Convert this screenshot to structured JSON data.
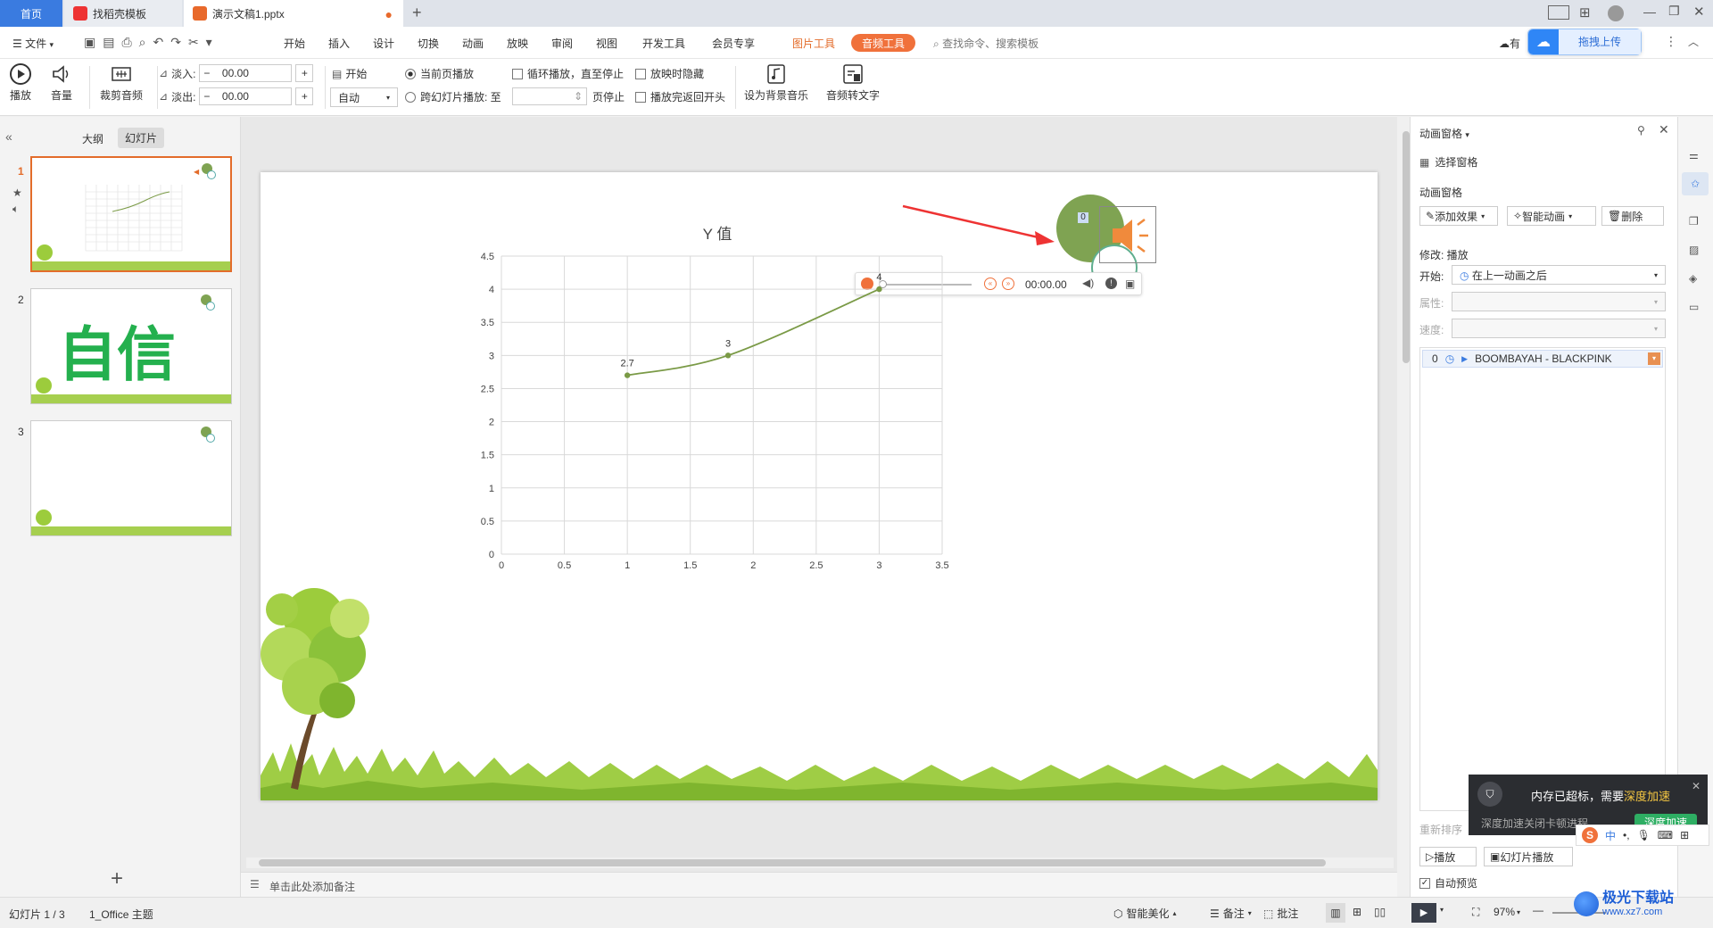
{
  "tabs": {
    "home": "首页",
    "template": "找稻壳模板",
    "file": "演示文稿1.pptx",
    "new_tab": "+"
  },
  "menu": {
    "file": "文件",
    "items": [
      "开始",
      "插入",
      "设计",
      "切换",
      "动画",
      "放映",
      "审阅",
      "视图",
      "开发工具",
      "会员专享"
    ],
    "picture_tools": "图片工具",
    "audio_tools": "音频工具",
    "search_placeholder": "查找命令、搜索模板",
    "upload": "拖拽上传",
    "has": "有"
  },
  "ribbon": {
    "play": "播放",
    "volume": "音量",
    "trim": "裁剪音频",
    "fade_in": "淡入:",
    "fade_in_val": "00.00",
    "fade_out": "淡出:",
    "fade_out_val": "00.00",
    "start": "开始",
    "start_val": "自动",
    "current_page": "当前页播放",
    "cross_slide": "跨幻灯片播放: 至",
    "page_stop": "页停止",
    "loop": "循环播放，直至停止",
    "hide": "放映时隐藏",
    "rewind": "播放完返回开头",
    "bg_music": "设为背景音乐",
    "to_text": "音频转文字"
  },
  "left": {
    "outline": "大纲",
    "slides": "幻灯片",
    "slide_nums": [
      "1",
      "2",
      "3"
    ],
    "slide2_text": "自信"
  },
  "slide": {
    "audio_index": "0",
    "time": "00:00.00"
  },
  "chart_data": {
    "type": "scatter",
    "title": "Y 值",
    "x": [
      1,
      1.8,
      3
    ],
    "y": [
      2.7,
      3,
      4
    ],
    "data_labels": [
      "2.7",
      "3",
      "4"
    ],
    "xlim": [
      0,
      3.5
    ],
    "ylim": [
      0,
      4.5
    ],
    "xticks": [
      "0",
      "0.5",
      "1",
      "1.5",
      "2",
      "2.5",
      "3",
      "3.5"
    ],
    "yticks": [
      "0",
      "0.5",
      "1",
      "1.5",
      "2",
      "2.5",
      "3",
      "3.5",
      "4",
      "4.5"
    ],
    "line_color": "#7a9a46",
    "grid": true,
    "smooth": true
  },
  "notes_placeholder": "单击此处添加备注",
  "right": {
    "title": "动画窗格",
    "select_pane": "选择窗格",
    "section": "动画窗格",
    "add_effect": "添加效果",
    "smart_anim": "智能动画",
    "delete": "删除",
    "modify": "修改: 播放",
    "start_label": "开始:",
    "start_val": "在上一动画之后",
    "attr_label": "属性:",
    "speed_label": "速度:",
    "anim_index": "0",
    "anim_name": "BOOMBAYAH - BLACKPINK",
    "reorder": "重新排序",
    "play_btn": "播放",
    "slideshow_btn": "幻灯片播放",
    "auto_preview": "自动预览"
  },
  "popup": {
    "title_a": "内存已超标，需要",
    "title_b": "深度加速",
    "sub": "深度加速关闭卡顿进程",
    "btn": "深度加速"
  },
  "status": {
    "slide": "幻灯片 1 / 3",
    "theme": "1_Office 主题",
    "beautify": "智能美化",
    "notes": "备注",
    "comment": "批注",
    "zoom": "97%"
  },
  "watermark": {
    "name": "极光下载站",
    "url": "www.xz7.com"
  },
  "colors": {
    "accent": "#3a7be0",
    "audio_tool": "#f0713b",
    "slide_sel": "#e36c2a",
    "speaker": "#f08a3c",
    "green": "#7fa352"
  }
}
